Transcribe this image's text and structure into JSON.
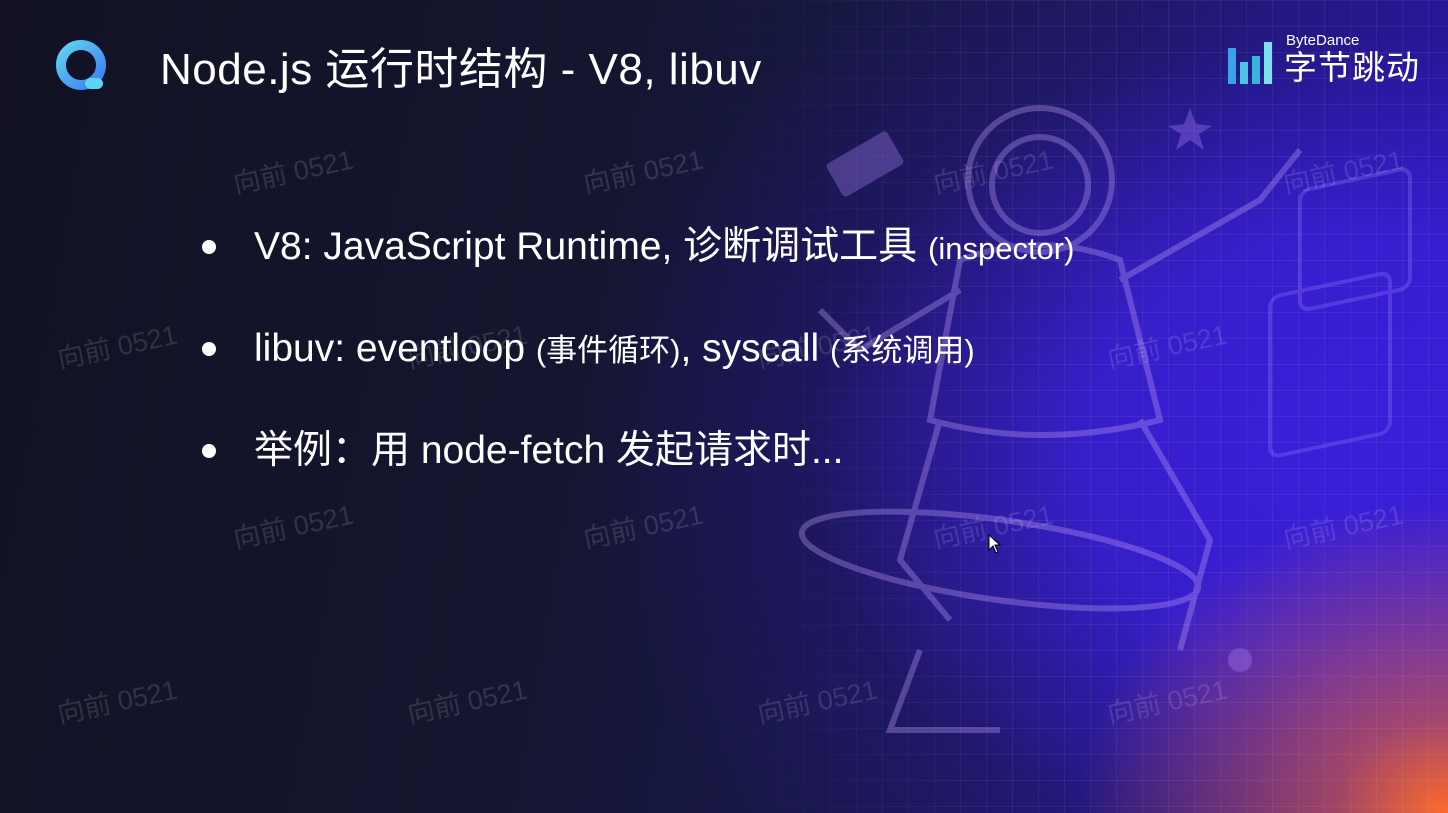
{
  "header": {
    "title": "Node.js 运行时结构 - V8, libuv",
    "brand_en": "ByteDance",
    "brand_cn": "字节跳动"
  },
  "bullets": [
    {
      "main": "V8: JavaScript Runtime, 诊断调试工具 ",
      "note": "(inspector)"
    },
    {
      "main": "libuv: eventloop ",
      "note": "(事件循环)",
      "main2": ", syscall ",
      "note2": "(系统调用)"
    },
    {
      "main": "举例：用 node-fetch 发起请求时..."
    }
  ],
  "watermark": "向前 0521",
  "icons": {
    "app_logo": "q-logo-icon",
    "brand_logo": "bytedance-bars-icon",
    "cursor": "mouse-cursor-icon"
  },
  "colors": {
    "background_dark": "#141630",
    "background_accent": "#3a1fd9",
    "corner_glow": "#ff6a2a",
    "logo_blue": "#3d7cf2",
    "logo_cyan": "#5fd3f2",
    "text": "#ffffff"
  }
}
